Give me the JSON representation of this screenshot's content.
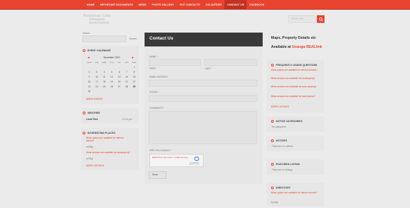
{
  "nav": {
    "items": [
      "HOME",
      "IMPORTANT DOCUMENTS",
      "NEWS",
      "PHOTO GALLERY",
      "POT CONTACTS",
      "VOLUNTEER",
      "CONTACT US",
      "FACEBOOK"
    ],
    "active_index": 6
  },
  "logo": {
    "lines": [
      "Poinsenay Lake",
      "Albuquer",
      "Association"
    ]
  },
  "header_search": {
    "placeholder": "Search here..."
  },
  "left": {
    "search_label": "Search",
    "search_button": "Search",
    "event_calendar": {
      "title": "EVENT CALENDAR",
      "month": "November 2020",
      "weekdays": [
        "MON",
        "TUE",
        "WED",
        "THU",
        "FRI",
        "SAT",
        "SUN"
      ],
      "rows": [
        [
          "",
          "",
          "",
          "",
          "",
          "",
          "1"
        ],
        [
          "2",
          "3",
          "4",
          "5",
          "6",
          "7",
          "8"
        ],
        [
          "9",
          "10",
          "11",
          "12",
          "13",
          "14",
          "15"
        ],
        [
          "16",
          "17",
          "18",
          "19",
          "20",
          "21",
          "22"
        ],
        [
          "23",
          "24",
          "25",
          "26",
          "27",
          "28",
          "29"
        ],
        [
          "30",
          "",
          "",
          "",
          "",
          "",
          ""
        ]
      ],
      "bold_day": "29",
      "more": "MORE EVENTS"
    },
    "weather": {
      "title": "WEATHER",
      "label": "Local Time",
      "value": "12:24 pm"
    },
    "interesting": {
      "title": "INTERESTING PLACES",
      "q1": "What options are available for internet service?",
      "q1_meta": "In FAQ",
      "q2": "What services are available for landscaping?",
      "q2_meta": "In FAQ",
      "more": "MORE LISTINGS"
    }
  },
  "contact": {
    "title": "Contact Us",
    "name_label": "NAME *",
    "first_label": "FIRST",
    "last_label": "LAST",
    "email_label": "EMAIL ADDRESS",
    "phone_label": "PHONE *",
    "comments_label": "COMMENTS *",
    "human_label": "ARE YOU HUMAN? *",
    "recaptcha_error": "ERROR for site owner: Invalid site key",
    "recaptcha_brand": "reCAPTCHA",
    "recaptcha_terms": "Privacy - Terms",
    "send_label": "Send"
  },
  "right": {
    "heading1": "Maps, Property Details etc",
    "heading2_prefix": "Available at",
    "heading2_link": "Geauga REALlink",
    "faq": {
      "title": "FREQUENTLY ASKED QUESTIONS",
      "items": [
        "What options are available for internet service?",
        "What services are available for landscaping?",
        "What services are available for snow plowing?",
        "What services are available for trash pickup?"
      ],
      "more": "MORE LISTINGS"
    },
    "notice": {
      "title": "NOTICE CATEGORIES",
      "body": "No categories"
    },
    "notices": {
      "title": "NOTICES",
      "body": "There are no notices"
    },
    "featured": {
      "title": "FEATURED LISTING",
      "body": "There are no listings"
    },
    "directory": {
      "title": "DIRECTORY",
      "q1": "What options are available for internet service?",
      "q1_meta": "In FAQ"
    }
  },
  "colors": {
    "accent": "#e8432f",
    "dark_header": "#3a3a3a",
    "background": "#ebebeb"
  }
}
